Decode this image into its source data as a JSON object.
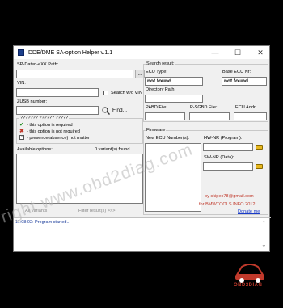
{
  "window": {
    "title": "DDE/DME SA-option Helper  v.1.1",
    "minimize": "—",
    "maximize": "☐",
    "close": "✕"
  },
  "left": {
    "sp_daten_label": "SP-Daten-eXX Path:",
    "browse": "...",
    "vin_label": "VIN:",
    "search_wo_vin": "Search w/o VIN",
    "zusb_label": "ZUSB number:",
    "find": "Find...",
    "legend_code": "??????? ?????? ?????",
    "legend_required": "- this option is required",
    "legend_not_required": "- this option is not required",
    "legend_presence": "- presence(absence) not matter",
    "available_options": "Available options:",
    "variants_found": "0 variant(s) found",
    "all_variants": "All variants",
    "filter_result": "Filter result(s) >>>"
  },
  "right": {
    "search_result": "Search result:",
    "ecu_type_label": "ECU Type:",
    "base_ecu_label": "Base ECU Nr:",
    "ecu_type_value": "not found",
    "base_ecu_value": "not found",
    "directory_path": "Directory Path:",
    "pabd_file": "PABD File:",
    "psgbd_file": "P-SGBD File:",
    "ecu_addr": "ECU Addr:",
    "firmware": "Firmware",
    "new_ecu_numbers": "New ECU Number(s):",
    "hw_nr": "HW-NR (Program):",
    "sw_nr": "SW-NR (Data):",
    "credit1": "by skipex78@gmail.com",
    "credit2": "for BMWTOOLS.INFO 2012",
    "donate": "Donate me"
  },
  "log": {
    "line1": "11:08:02:  Program started..."
  },
  "watermark": "right www.obd2diag.com",
  "logo_text": "OBD2DIAG",
  "colors": {
    "accent_red": "#c0392b",
    "link_blue": "#1a3cc8",
    "log_blue": "#1c3d9b"
  }
}
